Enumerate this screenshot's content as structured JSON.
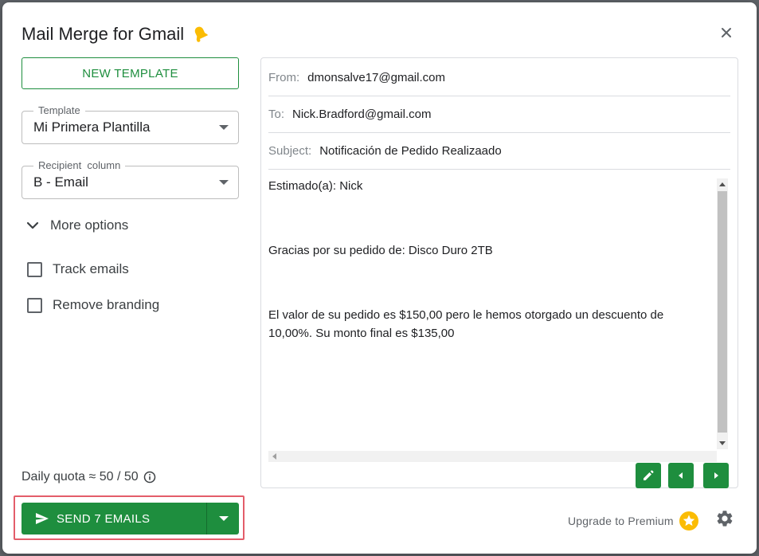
{
  "dialog": {
    "title": "Mail Merge for Gmail",
    "title_icon": "bell-icon",
    "close_icon": "close-icon"
  },
  "left": {
    "new_template_label": "NEW TEMPLATE",
    "template": {
      "label": "Template",
      "value": "Mi Primera Plantilla"
    },
    "recipient": {
      "label": "Recipient  column",
      "value": "B - Email"
    },
    "more_options_label": "More options",
    "checkboxes": [
      {
        "label": "Track emails",
        "checked": false
      },
      {
        "label": "Remove branding",
        "checked": false
      }
    ],
    "quota_text": "Daily quota ≈ 50 / 50",
    "send_label": "SEND 7 EMAILS"
  },
  "preview": {
    "from_label": "From:",
    "from_value": "dmonsalve17@gmail.com",
    "to_label": "To:",
    "to_value": "Nick.Bradford@gmail.com",
    "subject_label": "Subject:",
    "subject_value": "Notificación de Pedido Realizaado",
    "body": [
      "Estimado(a):  Nick",
      "Gracias por su pedido de: Disco Duro 2TB",
      "El valor de su pedido es $150,00 pero le hemos otorgado un descuento de 10,00%. Su monto final es $135,00"
    ]
  },
  "footer": {
    "upgrade_label": "Upgrade to Premium"
  },
  "colors": {
    "accent": "#1e8e3e",
    "highlight": "#e35d6a",
    "star": "#fbbc04"
  }
}
